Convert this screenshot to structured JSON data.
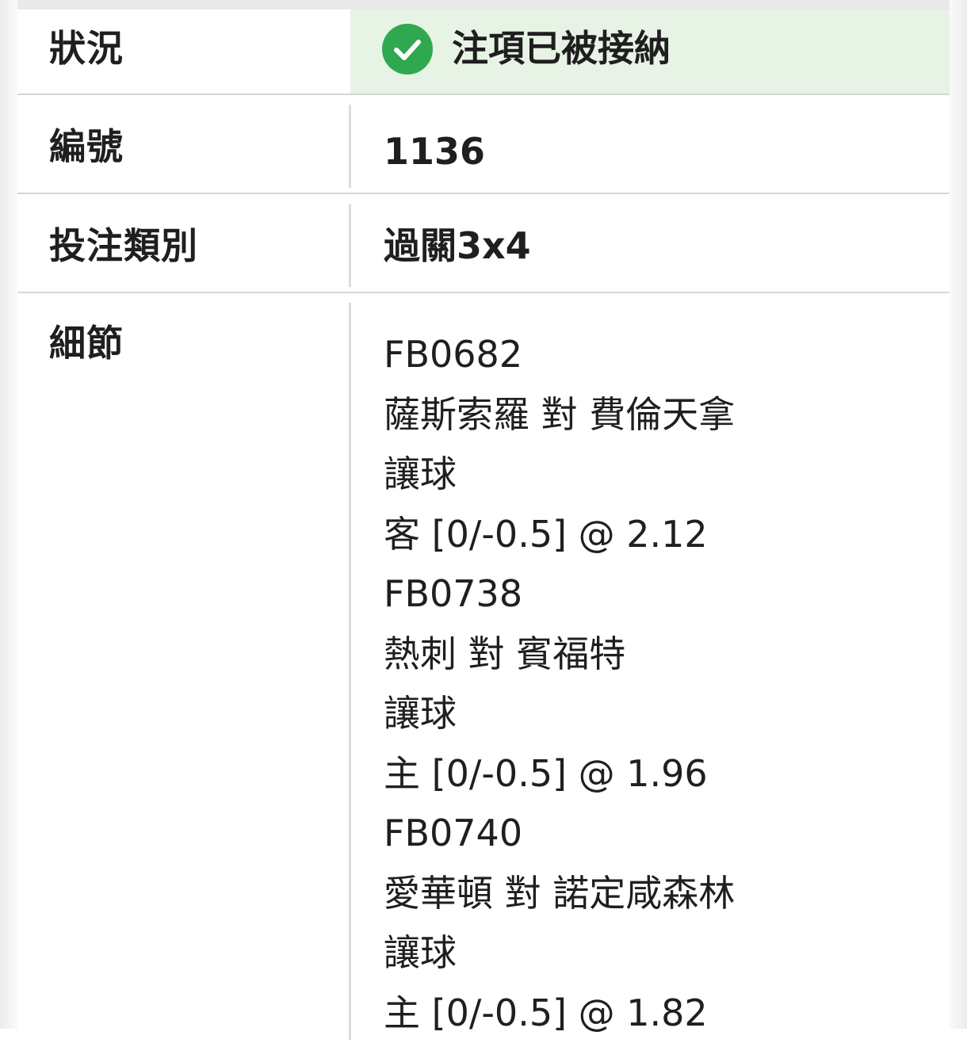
{
  "colors": {
    "status_bg": "#e7f3e4",
    "check_green": "#2fa84f",
    "divider": "#dcdcdc"
  },
  "rows": {
    "status": {
      "label": "狀況",
      "value": "注項已被接納",
      "icon": "check-circle-icon"
    },
    "id": {
      "label": "編號",
      "value": "1136"
    },
    "type": {
      "label": "投注類別",
      "value": "過關3x4"
    },
    "details": {
      "label": "細節",
      "lines": [
        "FB0682",
        "薩斯索羅 對 費倫天拿",
        "讓球",
        "客 [0/-0.5] @ 2.12",
        "FB0738",
        "熱刺 對 賓福特",
        "讓球",
        "主 [0/-0.5] @ 1.96",
        "FB0740",
        "愛華頓 對 諾定咸森林",
        "讓球",
        "主 [0/-0.5] @ 1.82"
      ]
    }
  }
}
